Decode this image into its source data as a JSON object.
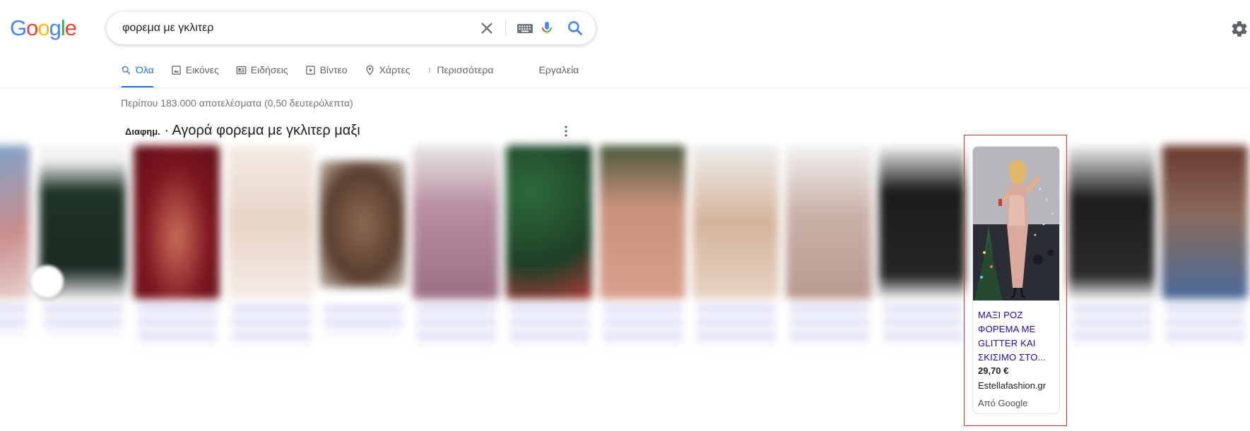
{
  "logo": {
    "l1": "G",
    "l2": "o",
    "l3": "o",
    "l4": "g",
    "l5": "l",
    "l6": "e"
  },
  "search": {
    "query": "φορεμα με γκλιτερ"
  },
  "tabs": [
    {
      "label": "Όλα",
      "icon": "search-icon"
    },
    {
      "label": "Εικόνες",
      "icon": "image-icon"
    },
    {
      "label": "Ειδήσεις",
      "icon": "news-icon"
    },
    {
      "label": "Βίντεο",
      "icon": "video-icon"
    },
    {
      "label": "Χάρτες",
      "icon": "map-pin-icon"
    },
    {
      "label": "Περισσότερα",
      "icon": "more-vert-icon"
    }
  ],
  "tools_label": "Εργαλεία",
  "results_stats": "Περίπου 183.000 αποτελέσματα (0,50 δευτερόλεπτα)",
  "shopping": {
    "ad_label": "Διαφημ.",
    "title": " · Αγορά φορεμα με γκλιτερ μαξι",
    "featured": {
      "title": "ΜΑΞΙ ΡΟΖ ΦΟΡΕΜΑ ΜΕ GLITTER ΚΑΙ ΣΚΙΣΙΜΟ ΣΤΟ...",
      "price": "29,70 €",
      "seller": "Estellafashion.gr",
      "via": "Από Google"
    }
  },
  "colors": {
    "accent": "#1a73e8",
    "link": "#1a0dab",
    "highlight_outline": "#b63c2e"
  }
}
